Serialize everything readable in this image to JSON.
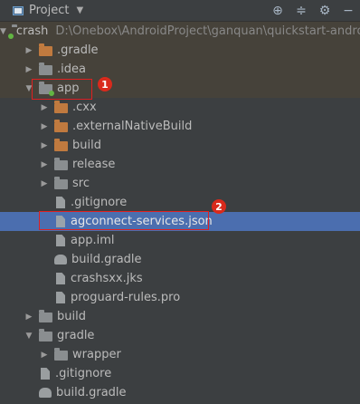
{
  "header": {
    "title": "Project",
    "tools": [
      "target-icon",
      "collapse-icon",
      "gear-icon",
      "hide-icon"
    ]
  },
  "tree": [
    {
      "name": "crash",
      "path": "D:\\Onebox\\AndroidProject\\ganquan\\quickstart-andro",
      "type": "module-folder",
      "expanded": true,
      "depth": 0
    },
    {
      "name": ".gradle",
      "type": "folder-orange",
      "expanded": false,
      "depth": 1
    },
    {
      "name": ".idea",
      "type": "folder",
      "expanded": false,
      "depth": 1
    },
    {
      "name": "app",
      "type": "module-folder",
      "expanded": true,
      "depth": 1
    },
    {
      "name": ".cxx",
      "type": "folder-orange",
      "expanded": false,
      "depth": 2
    },
    {
      "name": ".externalNativeBuild",
      "type": "folder-orange",
      "expanded": false,
      "depth": 2
    },
    {
      "name": "build",
      "type": "folder-orange",
      "expanded": false,
      "depth": 2
    },
    {
      "name": "release",
      "type": "folder",
      "expanded": false,
      "depth": 2
    },
    {
      "name": "src",
      "type": "folder",
      "expanded": false,
      "depth": 2
    },
    {
      "name": ".gitignore",
      "type": "file",
      "depth": 2
    },
    {
      "name": "agconnect-services.json",
      "type": "json",
      "depth": 2,
      "selected": true
    },
    {
      "name": "app.iml",
      "type": "iml",
      "depth": 2
    },
    {
      "name": "build.gradle",
      "type": "gradle",
      "depth": 2
    },
    {
      "name": "crashsxx.jks",
      "type": "file",
      "depth": 2
    },
    {
      "name": "proguard-rules.pro",
      "type": "file",
      "depth": 2
    },
    {
      "name": "build",
      "type": "folder",
      "expanded": false,
      "depth": 1
    },
    {
      "name": "gradle",
      "type": "folder",
      "expanded": true,
      "depth": 1
    },
    {
      "name": "wrapper",
      "type": "folder",
      "expanded": false,
      "depth": 2
    },
    {
      "name": ".gitignore",
      "type": "file",
      "depth": 1
    },
    {
      "name": "build.gradle",
      "type": "gradle",
      "depth": 1
    }
  ],
  "annotations": {
    "badge1": "1",
    "badge2": "2"
  },
  "colors": {
    "background": "#3c3f41",
    "selection": "#4b6eaf",
    "annotation": "#e02020"
  }
}
